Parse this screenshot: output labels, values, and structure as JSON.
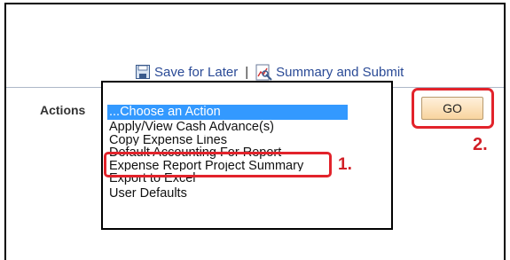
{
  "toolbar": {
    "save_label": "Save for Later",
    "separator": "|",
    "summary_label": "Summary and Submit",
    "save_icon": "floppy-disk-icon",
    "summary_icon": "summary-chart-icon"
  },
  "actions": {
    "label": "Actions",
    "options": [
      "...Choose an Action",
      "Apply/View Cash Advance(s)",
      "Copy Expense Lines",
      "Default Accounting For Report",
      "Expense Report Project Summary",
      "Export to Excel",
      "User Defaults"
    ],
    "selected_index": 0,
    "go_label": "GO"
  },
  "annotations": {
    "step1": "1.",
    "step2": "2.",
    "color": "#e2232b"
  }
}
